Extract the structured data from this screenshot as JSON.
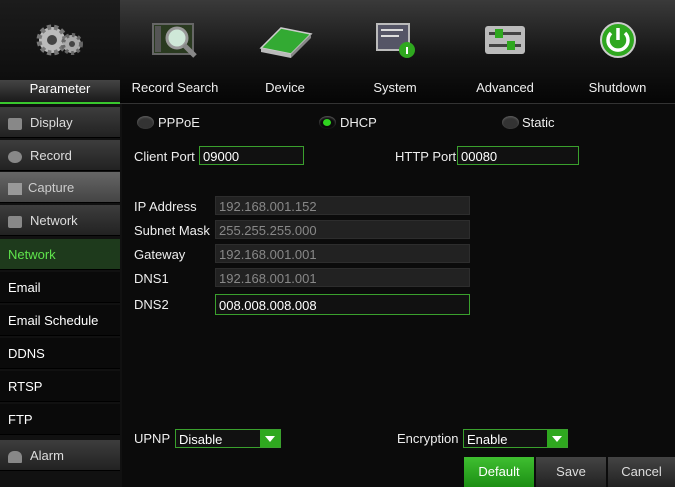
{
  "top_menu": [
    {
      "label": "Parameter",
      "icon": "gears-icon",
      "active": true
    },
    {
      "label": "Record Search",
      "icon": "magnifier-film-icon"
    },
    {
      "label": "Device",
      "icon": "hard-drive-icon"
    },
    {
      "label": "System",
      "icon": "system-info-icon"
    },
    {
      "label": "Advanced",
      "icon": "sliders-icon"
    },
    {
      "label": "Shutdown",
      "icon": "power-icon"
    }
  ],
  "sidebar": {
    "display": "Display",
    "record": "Record",
    "capture": "Capture",
    "network": "Network",
    "sub_network": "Network",
    "email": "Email",
    "email_schedule": "Email Schedule",
    "ddns": "DDNS",
    "rtsp": "RTSP",
    "ftp": "FTP",
    "alarm": "Alarm"
  },
  "form": {
    "mode_pppoe": "PPPoE",
    "mode_dhcp": "DHCP",
    "mode_static": "Static",
    "selected_mode": "DHCP",
    "client_port_label": "Client Port",
    "client_port": "09000",
    "http_port_label": "HTTP Port",
    "http_port": "00080",
    "ip_label": "IP Address",
    "ip": "192.168.001.152",
    "mask_label": "Subnet Mask",
    "mask": "255.255.255.000",
    "gateway_label": "Gateway",
    "gateway": "192.168.001.001",
    "dns1_label": "DNS1",
    "dns1": "192.168.001.001",
    "dns2_label": "DNS2",
    "dns2": "008.008.008.008",
    "upnp_label": "UPNP",
    "upnp": "Disable",
    "encryption_label": "Encryption",
    "encryption": "Enable"
  },
  "buttons": {
    "default": "Default",
    "save": "Save",
    "cancel": "Cancel"
  },
  "colors": {
    "accent": "#2fd41f",
    "background": "#0b0b0b"
  }
}
